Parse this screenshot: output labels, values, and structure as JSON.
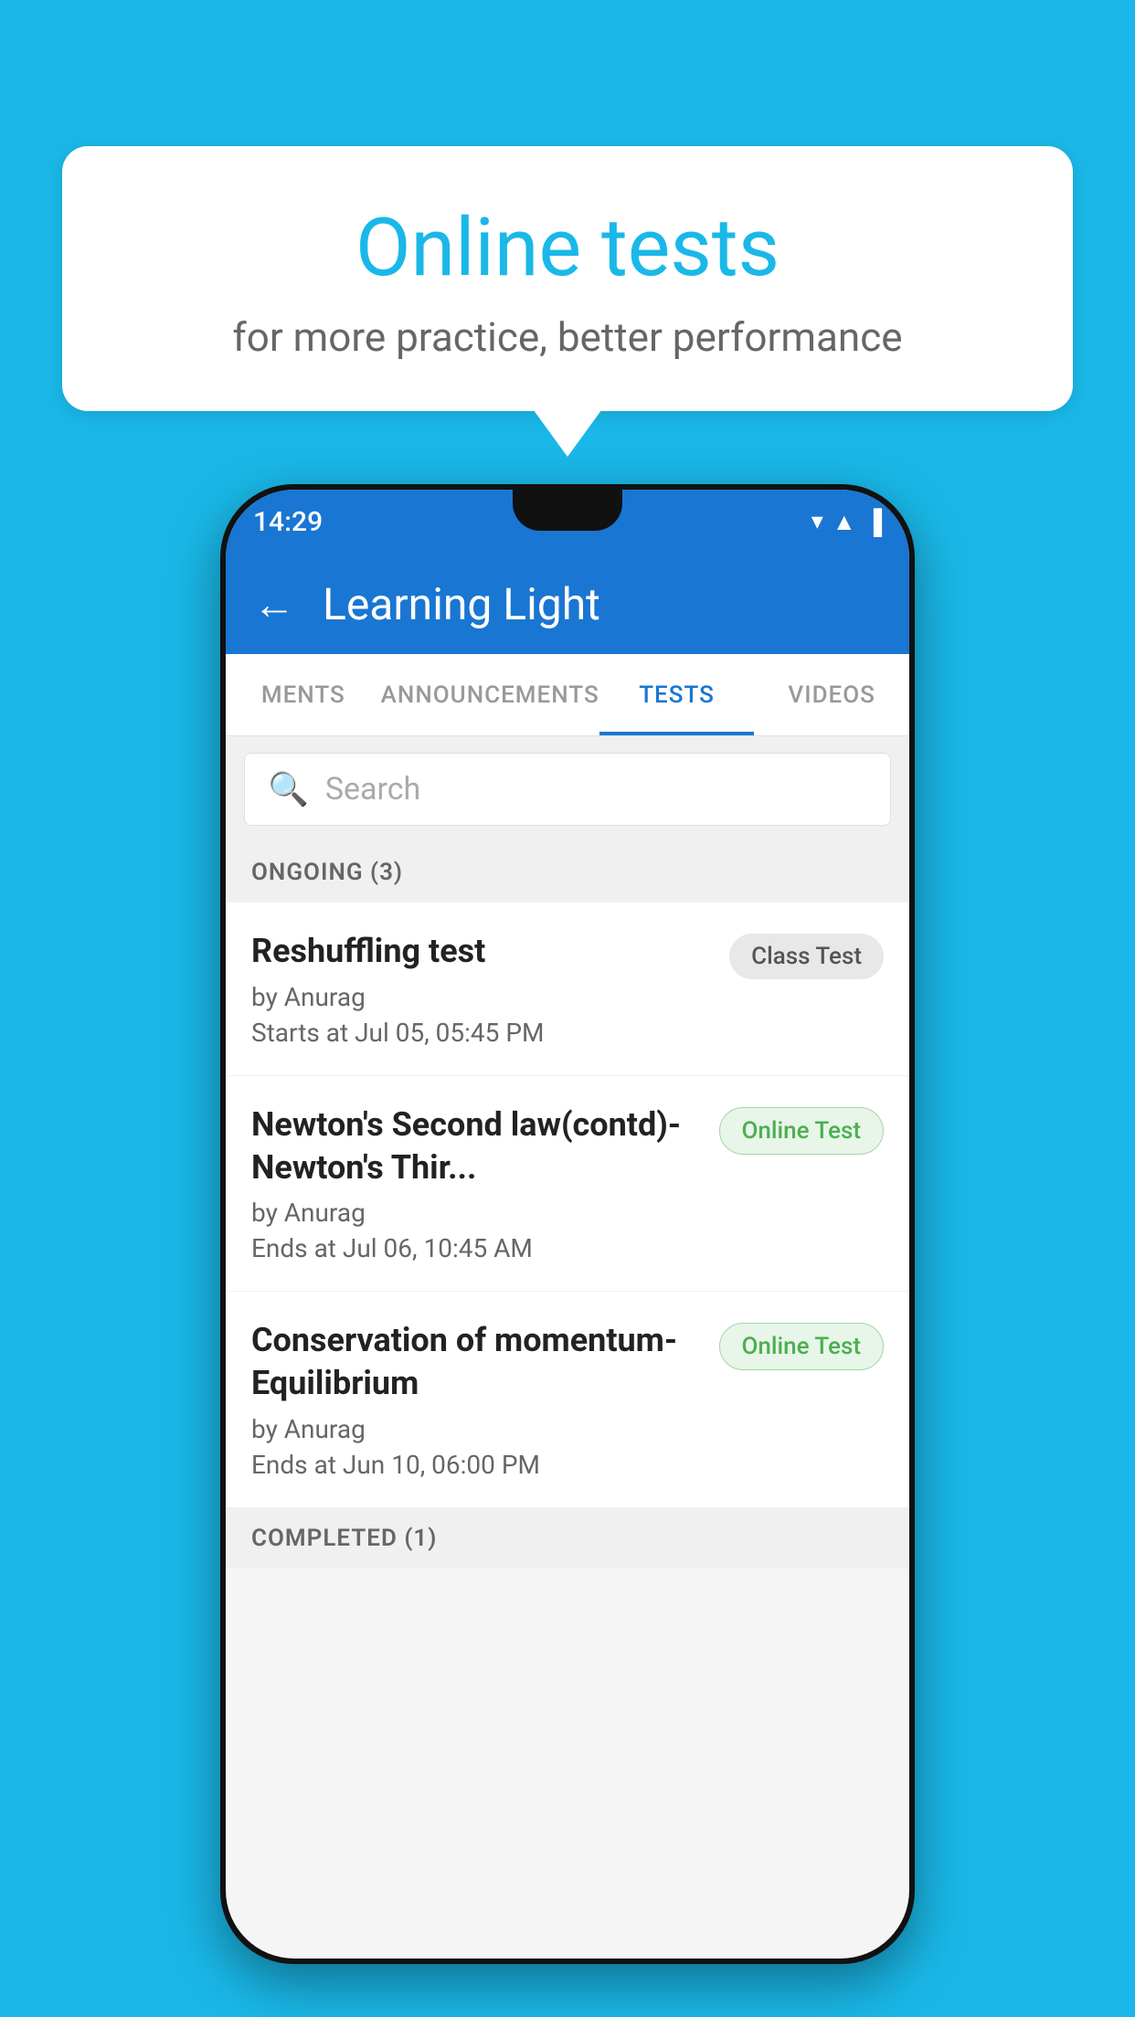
{
  "background": {
    "color": "#1ab8e8"
  },
  "bubble": {
    "title": "Online tests",
    "subtitle": "for more practice, better performance"
  },
  "phone": {
    "status_bar": {
      "time": "14:29",
      "icons": [
        "▼",
        "▲",
        "▐"
      ]
    },
    "app_bar": {
      "back_label": "←",
      "title": "Learning Light"
    },
    "tabs": [
      {
        "label": "MENTS",
        "active": false
      },
      {
        "label": "ANNOUNCEMENTS",
        "active": false
      },
      {
        "label": "TESTS",
        "active": true
      },
      {
        "label": "VIDEOS",
        "active": false
      }
    ],
    "search": {
      "placeholder": "Search"
    },
    "ongoing_section": {
      "label": "ONGOING (3)"
    },
    "tests": [
      {
        "name": "Reshuffling test",
        "author": "by Anurag",
        "time_label": "Starts at",
        "time": "Jul 05, 05:45 PM",
        "badge": "Class Test",
        "badge_type": "class"
      },
      {
        "name": "Newton's Second law(contd)-Newton's Thir...",
        "author": "by Anurag",
        "time_label": "Ends at",
        "time": "Jul 06, 10:45 AM",
        "badge": "Online Test",
        "badge_type": "online"
      },
      {
        "name": "Conservation of momentum-Equilibrium",
        "author": "by Anurag",
        "time_label": "Ends at",
        "time": "Jun 10, 06:00 PM",
        "badge": "Online Test",
        "badge_type": "online"
      }
    ],
    "completed_section": {
      "label": "COMPLETED (1)"
    }
  }
}
